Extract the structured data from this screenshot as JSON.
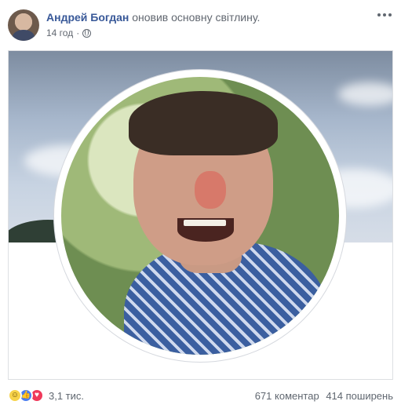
{
  "post": {
    "author": "Андрей Богдан",
    "action": "оновив основну світлину.",
    "time": "14 год",
    "separator": "·"
  },
  "footer": {
    "reaction_count": "3,1 тис.",
    "comments": "671 коментар",
    "shares": "414 поширень"
  },
  "icons": {
    "privacy": "globe-icon",
    "menu": "more-icon",
    "reactions": [
      "haha-icon",
      "like-icon",
      "love-icon"
    ]
  },
  "colors": {
    "author_link": "#385898",
    "secondary_text": "#606770",
    "like": "#4a7df0",
    "love": "#f0395b",
    "haha": "#f7d34a"
  }
}
